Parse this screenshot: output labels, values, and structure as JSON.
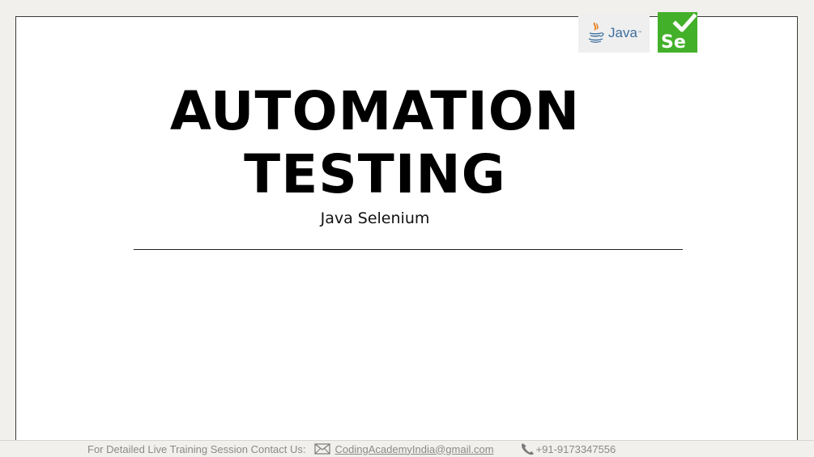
{
  "slide": {
    "title_line1": "AUTOMATION",
    "title_line2": "TESTING",
    "subtitle": "Java Selenium"
  },
  "logos": {
    "java": {
      "word": "Java",
      "tm": "™",
      "icon": "java-cup-icon"
    },
    "selenium": {
      "text": "Se",
      "icon": "selenium-check-icon",
      "color": "#43b02a"
    }
  },
  "footer": {
    "label": "For Detailed Live Training Session Contact Us:",
    "email": "CodingAcademyIndia@gmail.com",
    "phone": "+91-9173347556",
    "mail_icon": "envelope-icon",
    "phone_icon": "phone-icon"
  },
  "colors": {
    "background": "#f1f0ec",
    "slide": "#ffffff",
    "java_blue": "#3d6f9e",
    "java_orange": "#e76f00",
    "selenium_green": "#43b02a",
    "footer_text": "#8a8a8a"
  }
}
